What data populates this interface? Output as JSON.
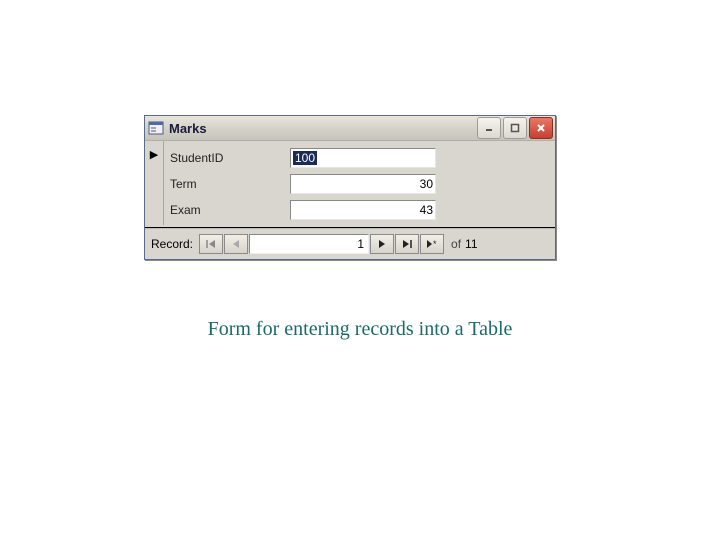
{
  "window": {
    "title": "Marks",
    "icons": {
      "form": "form-icon",
      "minimize": "minimize-icon",
      "maximize": "maximize-icon",
      "close": "close-icon"
    }
  },
  "fields": [
    {
      "label": "StudentID",
      "value": "100",
      "selected": true
    },
    {
      "label": "Term",
      "value": "30",
      "selected": false
    },
    {
      "label": "Exam",
      "value": "43",
      "selected": false
    }
  ],
  "nav": {
    "label": "Record:",
    "current": "1",
    "of_label": "of",
    "total": "11"
  },
  "caption": "Form for entering records into a Table"
}
